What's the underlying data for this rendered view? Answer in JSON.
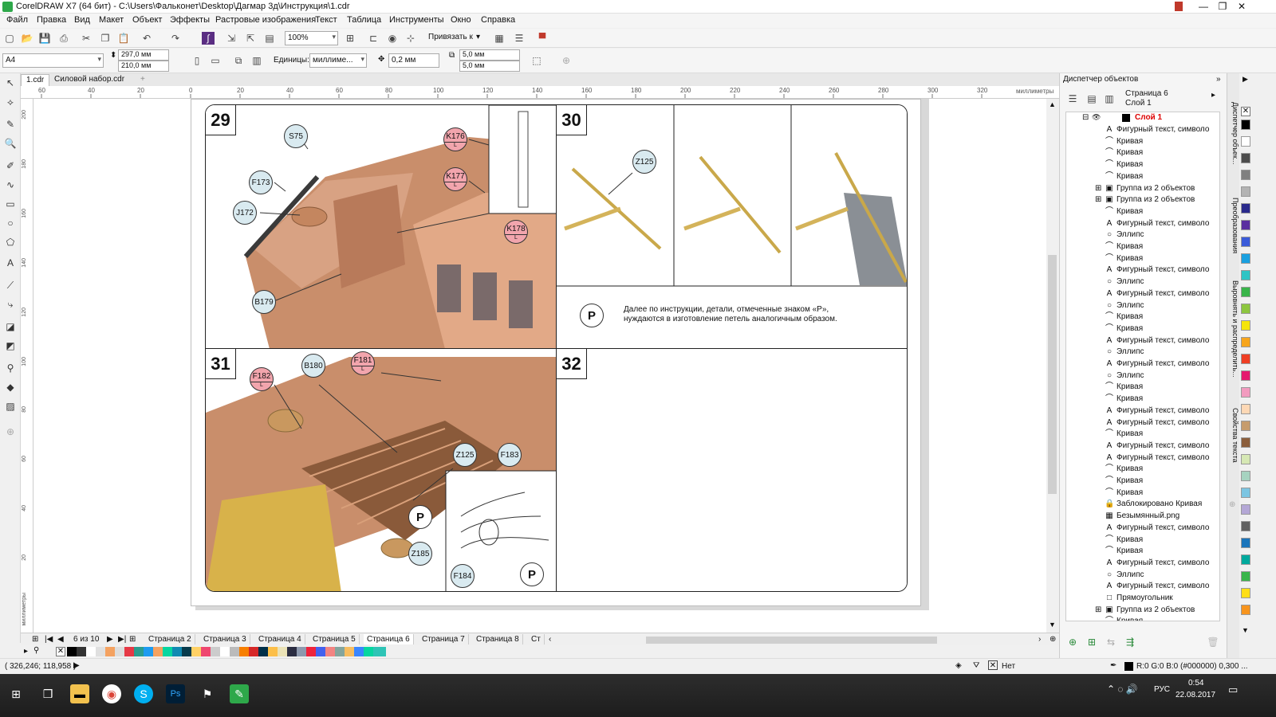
{
  "window": {
    "title": "CorelDRAW X7 (64 бит) - C:\\Users\\Фальконет\\Desktop\\Дагмар 3д\\Инструкция\\1.cdr",
    "minimize": "—",
    "maximize": "❐",
    "close": "✕"
  },
  "menu": [
    "Файл",
    "Правка",
    "Вид",
    "Макет",
    "Объект",
    "Эффекты",
    "Растровые изображения",
    "Текст",
    "Таблица",
    "Инструменты",
    "Окно",
    "Справка"
  ],
  "toolbar": {
    "zoom": "100%",
    "snap_label": "Привязать к"
  },
  "property_bar": {
    "page_size": "A4",
    "width": "297,0 мм",
    "height": "210,0 мм",
    "units_label": "Единицы:",
    "units_value": "миллиме...",
    "nudge": "0,2 мм",
    "dup_x": "5,0 мм",
    "dup_y": "5,0 мм"
  },
  "doc_tabs": [
    {
      "label": "1.cdr"
    },
    {
      "label": "Силовой набор.cdr"
    }
  ],
  "ruler": {
    "units": "миллиметры",
    "ticks": [
      "60",
      "40",
      "20",
      "0",
      "20",
      "40",
      "60",
      "80",
      "100",
      "120",
      "140",
      "160",
      "180",
      "200",
      "220",
      "240",
      "260",
      "280",
      "300",
      "320"
    ]
  },
  "ruler_v": {
    "units": "миллиметры",
    "ticks": [
      "200",
      "180",
      "160",
      "140",
      "120",
      "100",
      "80",
      "60",
      "40",
      "20"
    ]
  },
  "steps": {
    "s29": {
      "num": "29",
      "callouts": [
        "S75",
        "F173",
        "J172",
        "B179"
      ],
      "red": [
        "K176",
        "K177",
        "K178"
      ],
      "sub": "L"
    },
    "s30": {
      "num": "30",
      "callout": "Z125",
      "p": "P",
      "text1": "Далее по инструкции, детали, отмеченные знаком «P»,",
      "text2": "нуждаются в изготовление петель аналогичным образом."
    },
    "s31": {
      "num": "31",
      "callouts": [
        "B180",
        "Z125",
        "F183",
        "Z185",
        "F184"
      ],
      "red": [
        "F182",
        "F181"
      ],
      "sub": "L",
      "p": "P"
    },
    "s32": {
      "num": "32"
    }
  },
  "page_nav": {
    "counter": "6 из 10",
    "tabs": [
      "Страница 2",
      "Страница 3",
      "Страница 4",
      "Страница 5",
      "Страница 6",
      "Страница 7",
      "Страница 8",
      "Ст"
    ],
    "active": "Страница 6"
  },
  "status": {
    "coords": "( 326,246; 118,958 )",
    "fill_none": "Нет",
    "color_info": "R:0 G:0 B:0 (#000000)  0,300 ..."
  },
  "docker": {
    "title": "Диспетчер объектов",
    "page": "Страница 6",
    "layer": "Слой 1",
    "root": "Слой 1",
    "items": [
      {
        "icon": "A",
        "label": "Фигурный текст, символо"
      },
      {
        "icon": "⌒",
        "label": "Кривая"
      },
      {
        "icon": "⌒",
        "label": "Кривая"
      },
      {
        "icon": "⌒",
        "label": "Кривая"
      },
      {
        "icon": "⌒",
        "label": "Кривая"
      },
      {
        "icon": "▣",
        "label": "Группа из 2 объектов",
        "expand": "⊞"
      },
      {
        "icon": "▣",
        "label": "Группа из 2 объектов",
        "expand": "⊞"
      },
      {
        "icon": "⌒",
        "label": "Кривая"
      },
      {
        "icon": "A",
        "label": "Фигурный текст, символо"
      },
      {
        "icon": "○",
        "label": "Эллипс"
      },
      {
        "icon": "⌒",
        "label": "Кривая"
      },
      {
        "icon": "⌒",
        "label": "Кривая"
      },
      {
        "icon": "A",
        "label": "Фигурный текст, символо"
      },
      {
        "icon": "○",
        "label": "Эллипс"
      },
      {
        "icon": "A",
        "label": "Фигурный текст, символо"
      },
      {
        "icon": "○",
        "label": "Эллипс"
      },
      {
        "icon": "⌒",
        "label": "Кривая"
      },
      {
        "icon": "⌒",
        "label": "Кривая"
      },
      {
        "icon": "A",
        "label": "Фигурный текст, символо"
      },
      {
        "icon": "○",
        "label": "Эллипс"
      },
      {
        "icon": "A",
        "label": "Фигурный текст, символо"
      },
      {
        "icon": "○",
        "label": "Эллипс"
      },
      {
        "icon": "⌒",
        "label": "Кривая"
      },
      {
        "icon": "⌒",
        "label": "Кривая"
      },
      {
        "icon": "A",
        "label": "Фигурный текст, символо"
      },
      {
        "icon": "A",
        "label": "Фигурный текст, символо"
      },
      {
        "icon": "⌒",
        "label": "Кривая"
      },
      {
        "icon": "A",
        "label": "Фигурный текст, символо"
      },
      {
        "icon": "A",
        "label": "Фигурный текст, символо"
      },
      {
        "icon": "⌒",
        "label": "Кривая"
      },
      {
        "icon": "⌒",
        "label": "Кривая"
      },
      {
        "icon": "⌒",
        "label": "Кривая"
      },
      {
        "icon": "🔒",
        "label": "Заблокировано Кривая"
      },
      {
        "icon": "▦",
        "label": "Безымянный.png"
      },
      {
        "icon": "A",
        "label": "Фигурный текст, символо"
      },
      {
        "icon": "⌒",
        "label": "Кривая"
      },
      {
        "icon": "⌒",
        "label": "Кривая"
      },
      {
        "icon": "A",
        "label": "Фигурный текст, символо"
      },
      {
        "icon": "○",
        "label": "Эллипс"
      },
      {
        "icon": "A",
        "label": "Фигурный текст, символо"
      },
      {
        "icon": "□",
        "label": "Прямоугольник"
      },
      {
        "icon": "▣",
        "label": "Группа из 2 объектов",
        "expand": "⊞"
      },
      {
        "icon": "⌒",
        "label": "Кривая"
      }
    ]
  },
  "side_tabs": [
    "Диспетчер объек...",
    "Преобразования",
    "Выровнять и распределить...",
    "Свойства текста"
  ],
  "palette": [
    "#000000",
    "#ffffff",
    "#4d4d4d",
    "#808080",
    "#b3b3b3",
    "#2a2a8c",
    "#5a2fa0",
    "#3a5bd9",
    "#1aa0e0",
    "#2ec4c4",
    "#3ab54a",
    "#8dc63f",
    "#f5e50a",
    "#f7a51c",
    "#ef3e23",
    "#e5196e",
    "#f29bbf",
    "#fdd8b5",
    "#c69c6d",
    "#8b5e3c",
    "#d6e8b4",
    "#a6d3c0",
    "#7cc5e2",
    "#b4a7d6",
    "#606060",
    "#1b75bb",
    "#00a99d",
    "#39b54a",
    "#ffde17",
    "#f7941d"
  ],
  "taskbar": {
    "lang": "РУС",
    "time": "0:54",
    "date": "22.08.2017"
  }
}
